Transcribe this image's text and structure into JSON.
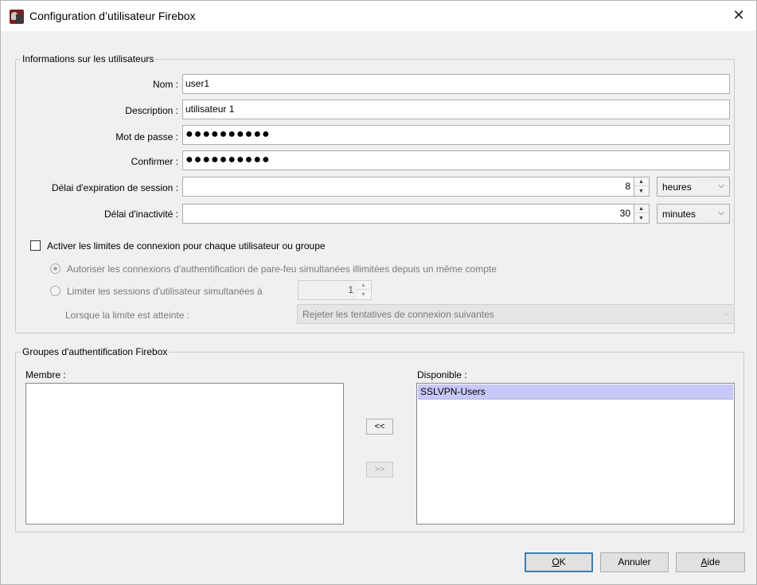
{
  "window": {
    "title": "Configuration d’utilisateur Firebox",
    "close_glyph": "✕",
    "icon": "firebox-app-icon"
  },
  "user_info": {
    "legend": "Informations sur les utilisateurs",
    "name_label": "Nom :",
    "name_value": "user1",
    "description_label": "Description :",
    "description_value": "utilisateur 1",
    "password_label": "Mot de passe :",
    "password_value": "●●●●●●●●●●",
    "confirm_label": "Confirmer :",
    "confirm_value": "●●●●●●●●●●",
    "session_timeout_label": "Délai d'expiration de session :",
    "session_timeout_value": "8",
    "session_timeout_unit": "heures",
    "idle_timeout_label": "Délai d'inactivité :",
    "idle_timeout_value": "30",
    "idle_timeout_unit": "minutes",
    "limits_checkbox_label": "Activer les limites de connexion pour chaque utilisateur ou groupe",
    "limits_checkbox_checked": false,
    "radio_unlimited_label": "Autoriser les connexions d'authentification de pare-feu simultanées illimitées depuis un même compte",
    "radio_limit_label": "Limiter les sessions d'utilisateur simultanées à",
    "limit_value": "1",
    "limit_reached_label": "Lorsque la limite est atteinte :",
    "limit_reached_value": "Rejeter les tentatives de connexion suivantes"
  },
  "groups": {
    "legend": "Groupes d'authentification Firebox",
    "member_label": "Membre :",
    "member_items": [],
    "available_label": "Disponible :",
    "available_items": [
      "SSLVPN-Users"
    ],
    "add_button": "<<",
    "remove_button": ">>"
  },
  "footer": {
    "ok_prefix": "",
    "ok_underlined": "O",
    "ok_suffix": "K",
    "cancel": "Annuler",
    "help_underlined": "A",
    "help_suffix": "ide"
  },
  "icons": {
    "spin_up": "▲",
    "spin_down": "▼",
    "chevron": "⌵"
  }
}
